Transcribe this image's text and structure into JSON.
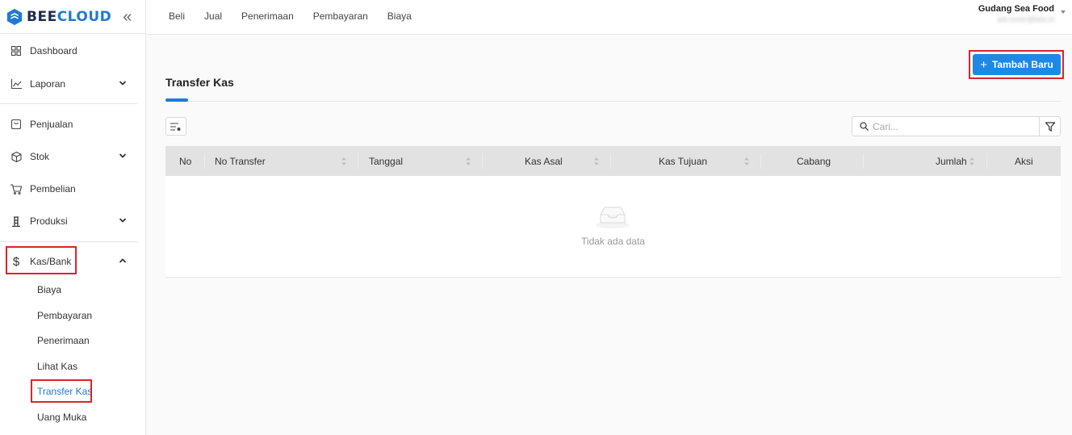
{
  "brand": {
    "part1": "BEE",
    "part2": "CLOUD"
  },
  "sidebar": {
    "items": [
      {
        "label": "Dashboard",
        "icon": "grid-icon"
      },
      {
        "label": "Laporan",
        "icon": "chart-line-icon"
      },
      {
        "label": "Penjualan",
        "icon": "tag-icon"
      },
      {
        "label": "Stok",
        "icon": "box-icon"
      },
      {
        "label": "Pembelian",
        "icon": "cart-icon"
      },
      {
        "label": "Produksi",
        "icon": "factory-icon"
      },
      {
        "label": "Kas/Bank",
        "icon": "dollar-icon"
      }
    ],
    "kas_sub": [
      "Biaya",
      "Pembayaran",
      "Penerimaan",
      "Lihat Kas",
      "Transfer Kas",
      "Uang Muka"
    ]
  },
  "topnav": [
    "Beli",
    "Jual",
    "Penerimaan",
    "Pembayaran",
    "Biaya"
  ],
  "user": {
    "company": "Gudang Sea Food",
    "email": "adi.nover@bee.id"
  },
  "page": {
    "title": "Transfer Kas",
    "add_button": "Tambah Baru"
  },
  "search": {
    "placeholder": "Cari..."
  },
  "table": {
    "columns": [
      "No",
      "No Transfer",
      "Tanggal",
      "Kas Asal",
      "Kas Tujuan",
      "Cabang",
      "Jumlah",
      "Aksi"
    ],
    "empty_text": "Tidak ada data"
  },
  "colors": {
    "accent": "#1e88e5",
    "highlight": "#d9252a"
  }
}
